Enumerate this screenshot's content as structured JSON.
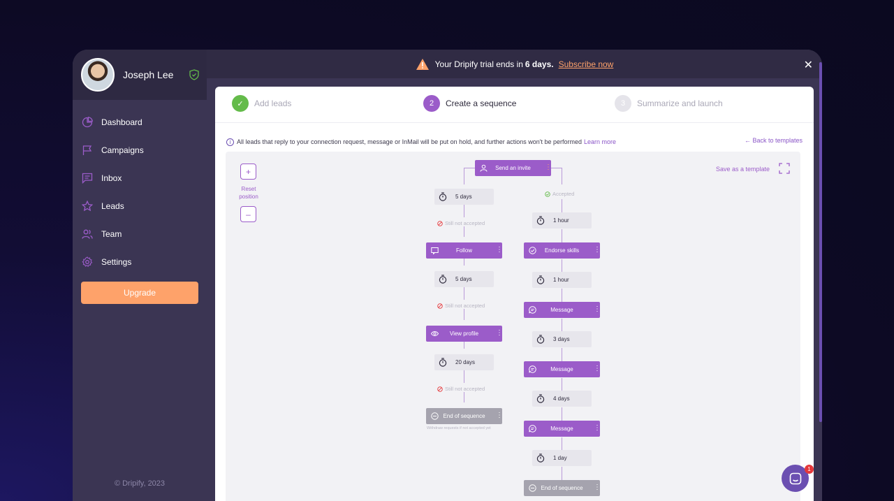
{
  "profile": {
    "name": "Joseph Lee"
  },
  "sidebar": {
    "items": [
      {
        "label": "Dashboard",
        "icon": "pie-chart-icon"
      },
      {
        "label": "Campaigns",
        "icon": "flag-icon"
      },
      {
        "label": "Inbox",
        "icon": "message-icon"
      },
      {
        "label": "Leads",
        "icon": "star-icon"
      },
      {
        "label": "Team",
        "icon": "users-icon"
      },
      {
        "label": "Settings",
        "icon": "gear-icon"
      }
    ],
    "upgrade_label": "Upgrade",
    "copyright": "© Dripify, 2023"
  },
  "trial": {
    "prefix": "Your Dripify trial ends in",
    "days": "6 days.",
    "link": "Subscribe now",
    "close": "✕"
  },
  "steps": [
    {
      "label": "Add leads",
      "num": "✓"
    },
    {
      "label": "Create a sequence",
      "num": "2"
    },
    {
      "label": "Summarize and launch",
      "num": "3"
    }
  ],
  "info": {
    "icon": "i",
    "text": "All leads that reply to your connection request, message or InMail will be put on hold, and further actions won't be performed",
    "link": "Learn more",
    "back": "← Back to templates"
  },
  "canvas": {
    "zoom_in": "+",
    "reset": "Reset position",
    "zoom_out": "–",
    "save_template": "Save as a template"
  },
  "sequence": {
    "root": "Send an invite",
    "accepted": "Accepted",
    "left": {
      "delay1": "5 days",
      "cond1": "Still not accepted",
      "action1": "Follow",
      "delay2": "5 days",
      "cond2": "Still not accepted",
      "action2": "View profile",
      "delay3": "20 days",
      "cond3": "Still not accepted",
      "end": "End of sequence",
      "end_note": "Withdraw requests if not accepted yet"
    },
    "right": {
      "delay1": "1 hour",
      "action1": "Endorse skills",
      "delay2": "1 hour",
      "action2": "Message",
      "delay3": "3 days",
      "action3": "Message",
      "delay4": "4 days",
      "action4": "Message",
      "delay5": "1 day",
      "end": "End of sequence"
    }
  },
  "chat": {
    "badge": "1"
  },
  "colors": {
    "accent": "#9b5cc9",
    "orange": "#fea26a",
    "success": "#64bb4a",
    "sidebar": "#3b3553"
  }
}
